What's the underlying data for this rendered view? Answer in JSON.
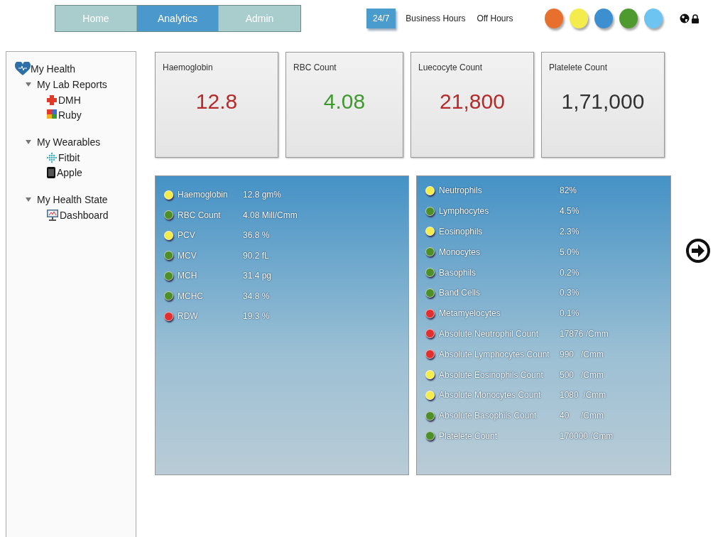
{
  "nav": {
    "tabs": [
      {
        "label": "Home",
        "selected": false
      },
      {
        "label": "Analytics",
        "selected": true
      },
      {
        "label": "Admin",
        "selected": false
      }
    ]
  },
  "schedule": [
    {
      "label": "24/7",
      "selected": true
    },
    {
      "label": "Business Hours",
      "selected": false
    },
    {
      "label": "Off Hours",
      "selected": false
    }
  ],
  "palette": [
    {
      "color": "#e8702f"
    },
    {
      "color": "#f3ec4c"
    },
    {
      "color": "#3d8fd0"
    },
    {
      "color": "#4f9a2e"
    },
    {
      "color": "#6ec4f0"
    }
  ],
  "sidebar": {
    "title": "My Health",
    "groups": [
      {
        "label": "My Lab Reports",
        "expanded": true,
        "children": [
          {
            "label": "DMH"
          },
          {
            "label": "Ruby"
          }
        ]
      },
      {
        "label": "My Wearables",
        "expanded": true,
        "children": [
          {
            "label": "Fitbit"
          },
          {
            "label": "Apple"
          }
        ]
      },
      {
        "label": "My Health State",
        "expanded": true,
        "children": [
          {
            "label": "Dashboard"
          }
        ]
      }
    ]
  },
  "cards": [
    {
      "title": "Haemoglobin",
      "value": "12.8",
      "color": "#b52a2a"
    },
    {
      "title": "RBC Count",
      "value": "4.08",
      "color": "#3f9a2f"
    },
    {
      "title": "Luecocyte Count",
      "value": "21,800",
      "color": "#b52a2a"
    },
    {
      "title": "Platelete Count",
      "value": "1,71,000",
      "color": "#333333"
    }
  ],
  "panels": [
    {
      "rows": [
        {
          "name": "Haemoglobin",
          "value": "12.8 gm%",
          "color": "#f3ec4c"
        },
        {
          "name": "RBC Count",
          "value": "4.08 Mill/Cmm",
          "color": "#4f8f2a"
        },
        {
          "name": "PCV",
          "value": "36.8 %",
          "color": "#f3ec4c"
        },
        {
          "name": "MCV",
          "value": "90.2 fL",
          "color": "#4f8f2a"
        },
        {
          "name": "MCH",
          "value": "31.4 pg",
          "color": "#4f8f2a"
        },
        {
          "name": "MCHC",
          "value": "34.8 %",
          "color": "#4f8f2a"
        },
        {
          "name": "RDW",
          "value": "19.3 %",
          "color": "#e03030"
        }
      ]
    },
    {
      "rows": [
        {
          "name": "Neutrophils",
          "value": "82%",
          "color": "#f3ec4c"
        },
        {
          "name": "Lymphocytes",
          "value": "4.5%",
          "color": "#4f8f2a"
        },
        {
          "name": "Eosinophils",
          "value": "2.3%",
          "color": "#f3ec4c"
        },
        {
          "name": "Monocytes",
          "value": "5.0%",
          "color": "#4f8f2a"
        },
        {
          "name": "Basophils",
          "value": "0.2%",
          "color": "#4f8f2a"
        },
        {
          "name": "Band Cells",
          "value": "0.3%",
          "color": "#4f8f2a"
        },
        {
          "name": "Metamyelocytes",
          "value": "0.1%",
          "color": "#e03030"
        },
        {
          "name": "Absolute Neutrophil Count",
          "value": "17876 /Cmm",
          "color": "#e03030"
        },
        {
          "name": "Absolute Lymphocytes Count",
          "value": "990   /Cmm",
          "color": "#e03030"
        },
        {
          "name": "Absolute Eosinophils Count",
          "value": "500   /Cmm",
          "color": "#f3ec4c"
        },
        {
          "name": "Absolute Monocytes Count",
          "value": "1080  /Cmm",
          "color": "#f3ec4c"
        },
        {
          "name": "Absolute Basophils Count",
          "value": "40     /Cmm",
          "color": "#4f8f2a"
        },
        {
          "name": "Platelete Count",
          "value": "170000 /Cmm",
          "color": "#4f8f2a"
        }
      ]
    }
  ]
}
